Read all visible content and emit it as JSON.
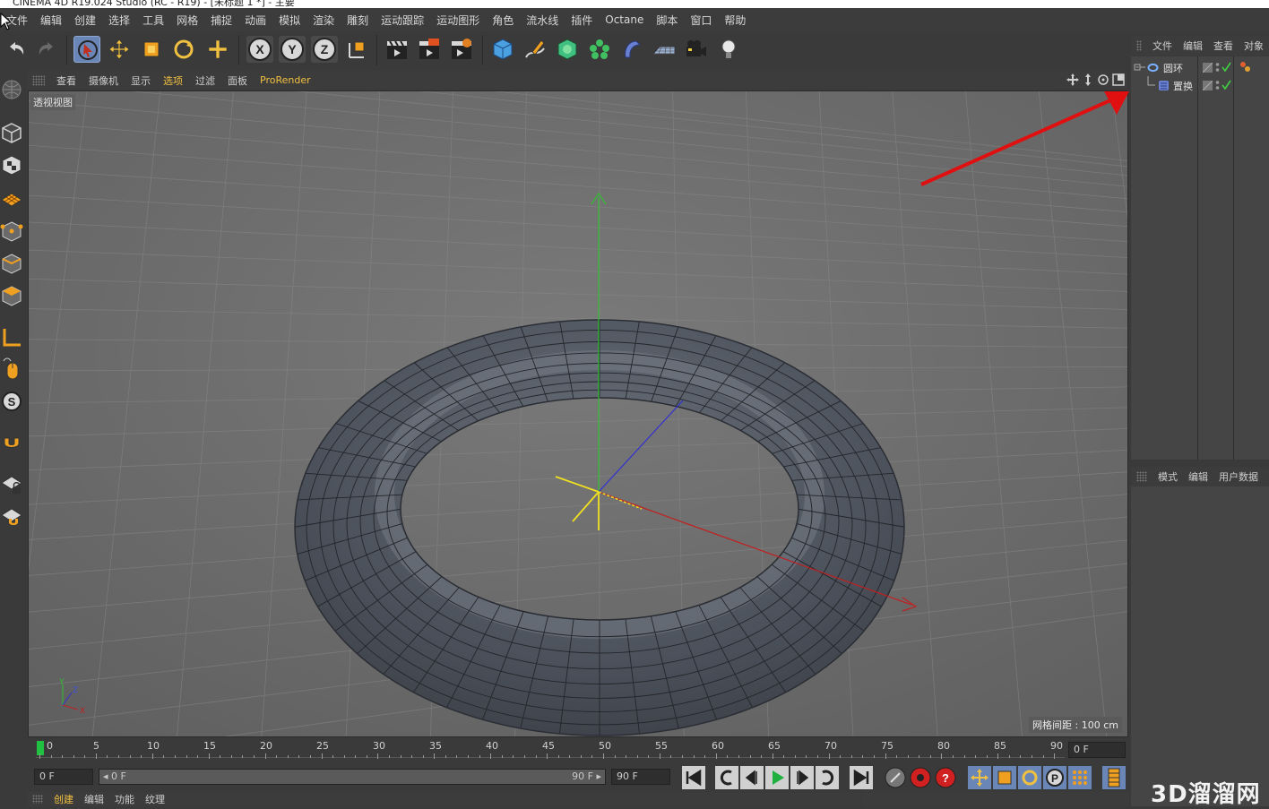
{
  "window": {
    "title": "CINEMA 4D R19.024 Studio (RC - R19) - [未标题 1 *] - 主要"
  },
  "menubar": {
    "items": [
      "文件",
      "编辑",
      "创建",
      "选择",
      "工具",
      "网格",
      "捕捉",
      "动画",
      "模拟",
      "渲染",
      "雕刻",
      "运动跟踪",
      "运动图形",
      "角色",
      "流水线",
      "插件",
      "Octane",
      "脚本",
      "窗口",
      "帮助"
    ]
  },
  "viewport": {
    "menu": [
      "查看",
      "摄像机",
      "显示",
      "选项",
      "过滤",
      "面板",
      "ProRender"
    ],
    "label": "透视视图",
    "grid_spacing": "网格间距 : 100 cm",
    "axis_labels": {
      "y": "Y",
      "z": "Z",
      "x": "X"
    }
  },
  "object_manager": {
    "tabs": [
      "文件",
      "编辑",
      "查看",
      "对象"
    ],
    "objects": [
      {
        "name": "圆环",
        "icon": "torus-icon"
      },
      {
        "name": "置换",
        "icon": "displace-deformer-icon"
      }
    ]
  },
  "attribute_manager": {
    "tabs": [
      "模式",
      "编辑",
      "用户数据"
    ]
  },
  "timeline": {
    "ticks": [
      "0",
      "5",
      "10",
      "15",
      "20",
      "25",
      "30",
      "35",
      "40",
      "45",
      "50",
      "55",
      "60",
      "65",
      "70",
      "75",
      "80",
      "85",
      "90"
    ],
    "current_frame": "0 F",
    "start_frame": "0 F",
    "range_start": "0 F",
    "range_end": "90 F",
    "end_frame": "90 F"
  },
  "bottom_panel": {
    "tabs": [
      "创建",
      "编辑",
      "功能",
      "纹理"
    ]
  },
  "watermark": "3D溜溜网",
  "colors": {
    "accent_yellow": "#f0c040",
    "selected_blue": "#6a86b6",
    "arrow_red": "#e01010"
  }
}
